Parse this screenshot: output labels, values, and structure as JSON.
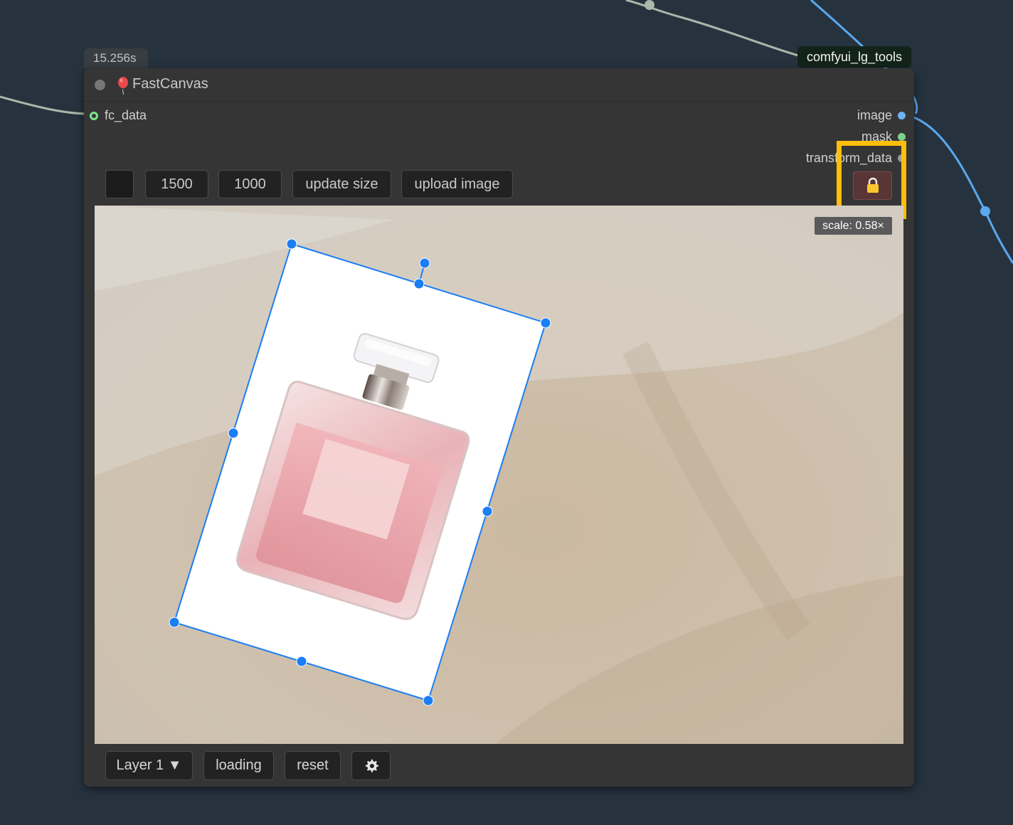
{
  "execution_time": "15.256s",
  "group_badge": "comfyui_lg_tools",
  "node": {
    "title": "FastCanvas",
    "inputs": [
      {
        "name": "fc_data"
      }
    ],
    "outputs": [
      {
        "name": "image",
        "color": "#6fb0f5"
      },
      {
        "name": "mask",
        "color": "#7ed08a"
      },
      {
        "name": "transform_data",
        "color": "#9a9a9a"
      }
    ]
  },
  "toolbar": {
    "color_swatch": "#1c1c1c",
    "width_value": "1500",
    "height_value": "1000",
    "update_size_label": "update size",
    "upload_image_label": "upload image",
    "lock_icon": "lock-icon"
  },
  "scale_label": "scale: 0.58×",
  "bottom_bar": {
    "layer_select": "Layer 1 ▼",
    "loading_label": "loading",
    "reset_label": "reset",
    "settings_icon": "gear-icon"
  },
  "colors": {
    "accent": "#1a7ef5",
    "highlight": "#ffbe0b",
    "wire_blue": "#5aa8ee",
    "wire_grey": "#a9b8a9"
  }
}
